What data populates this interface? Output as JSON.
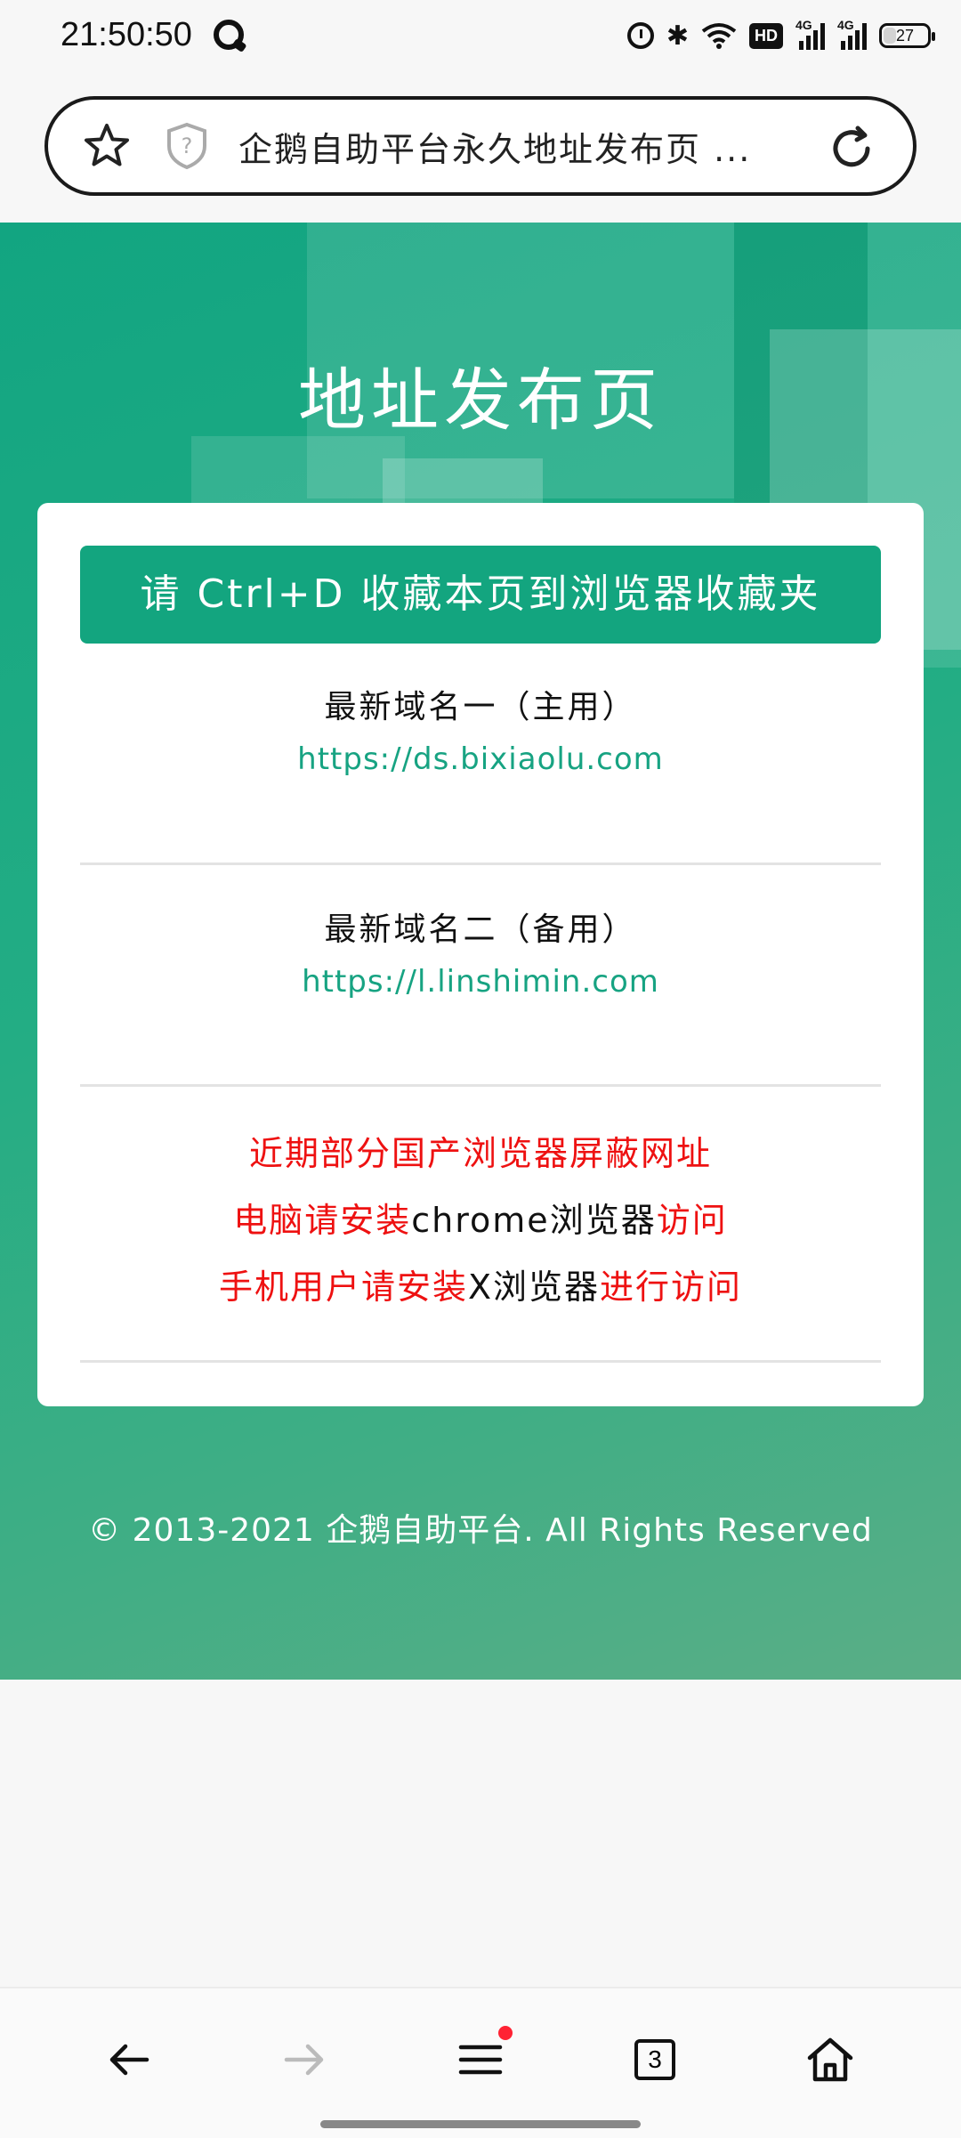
{
  "status_bar": {
    "time": "21:50:50",
    "network_badge": "HD",
    "signal_1_label": "4G",
    "signal_2_label": "4G",
    "battery_level": "27"
  },
  "address_bar": {
    "title": "企鹅自助平台永久地址发布页 ..."
  },
  "page": {
    "title": "地址发布页",
    "bookmark_banner": "请 Ctrl+D 收藏本页到浏览器收藏夹",
    "domains": [
      {
        "label": "最新域名一（主用）",
        "url": "https://ds.bixiaolu.com"
      },
      {
        "label": "最新域名二（备用）",
        "url": "https://l.linshimin.com"
      }
    ],
    "notice": {
      "line1": "近期部分国产浏览器屏蔽网址",
      "line2_a": "电脑请安装",
      "line2_b": "chrome浏览器",
      "line2_c": "访问",
      "line3_a": "手机用户请安装",
      "line3_b": "X浏览器",
      "line3_c": "进行访问"
    },
    "footer": "© 2013-2021 企鹅自助平台. All Rights Reserved"
  },
  "bottom_nav": {
    "tab_count": "3"
  },
  "colors": {
    "brand_green": "#13a57f",
    "link_green": "#17a382",
    "notice_red": "#e11111"
  },
  "icons": [
    "star-icon",
    "shield-question-icon",
    "reload-icon",
    "back-arrow-icon",
    "forward-arrow-icon",
    "menu-icon",
    "tabs-icon",
    "home-icon"
  ]
}
